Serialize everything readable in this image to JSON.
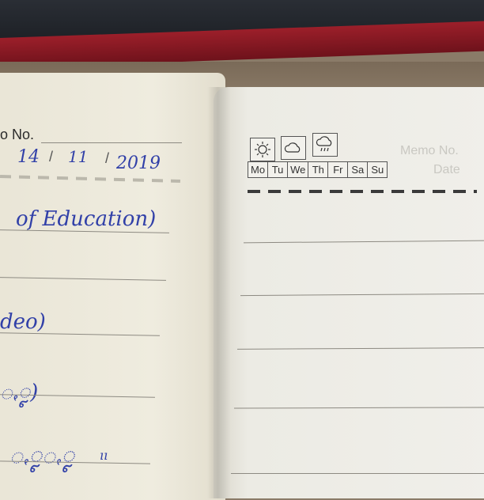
{
  "left_page": {
    "no_label": "o No.",
    "date_day": "14",
    "date_sep1": "/",
    "date_month": "11",
    "date_sep2": "/",
    "date_year": "2019",
    "line1": "of Education)",
    "line2": "deo)",
    "line3": "ꩻꨵ)",
    "line4": "ꩻꨵꩻꨵ",
    "line4_mark": "ıı"
  },
  "right_page": {
    "weather_icons": [
      "sun-icon",
      "cloudy-icon",
      "rain-icon"
    ],
    "days": [
      "Mo",
      "Tu",
      "We",
      "Th",
      "Fr",
      "Sa",
      "Su"
    ],
    "ghost_memo": "Memo No.",
    "ghost_date": "Date"
  }
}
